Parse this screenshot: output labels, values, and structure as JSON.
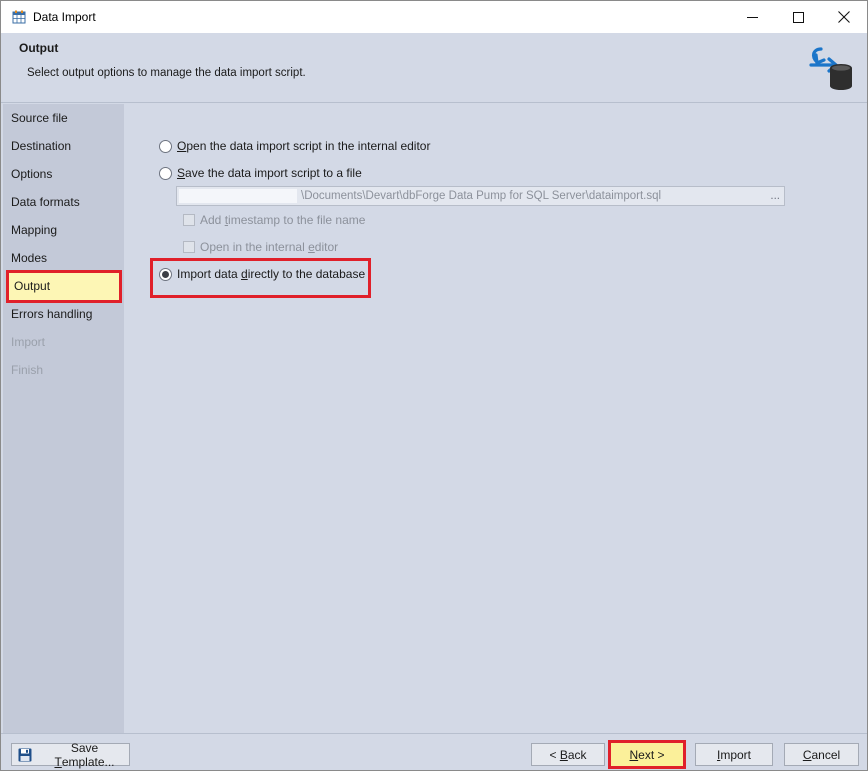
{
  "window": {
    "title": "Data Import",
    "controls": {
      "minimize": "minimize",
      "maximize": "maximize",
      "close": "close"
    }
  },
  "header": {
    "title": "Output",
    "subtitle": "Select output options to manage the data import script."
  },
  "sidebar": {
    "items": [
      {
        "label": "Source file",
        "state": "normal"
      },
      {
        "label": "Destination",
        "state": "normal"
      },
      {
        "label": "Options",
        "state": "normal"
      },
      {
        "label": "Data formats",
        "state": "normal"
      },
      {
        "label": "Mapping",
        "state": "normal"
      },
      {
        "label": "Modes",
        "state": "normal"
      },
      {
        "label": "Output",
        "state": "active"
      },
      {
        "label": "Errors handling",
        "state": "normal"
      },
      {
        "label": "Import",
        "state": "disabled"
      },
      {
        "label": "Finish",
        "state": "disabled"
      }
    ]
  },
  "output": {
    "option_open_editor": {
      "pre": "",
      "access": "O",
      "post": "pen the data import script in the internal editor",
      "selected": false
    },
    "option_save_file": {
      "pre": "",
      "access": "S",
      "post": "ave the data import script to a file",
      "selected": false
    },
    "file_path": "\\Documents\\Devart\\dbForge Data Pump for SQL Server\\dataimport.sql",
    "browse_label": "...",
    "check_timestamp": {
      "pre": "Add ",
      "access": "t",
      "post": "imestamp to the file name",
      "checked": false,
      "enabled": false
    },
    "check_open_editor": {
      "pre": "Open in the internal ",
      "access": "e",
      "post": "ditor",
      "checked": false,
      "enabled": false
    },
    "option_import_direct": {
      "pre": "Import data ",
      "access": "d",
      "post": "irectly to the database",
      "selected": true
    }
  },
  "footer": {
    "save_template": {
      "pre": "Save ",
      "access": "T",
      "post": "emplate..."
    },
    "back": {
      "pre": "< ",
      "access": "B",
      "post": "ack"
    },
    "next": {
      "pre": "",
      "access": "N",
      "post": "ext >"
    },
    "import": {
      "pre": "",
      "access": "I",
      "post": "mport"
    },
    "cancel": {
      "pre": "",
      "access": "C",
      "post": "ancel"
    }
  },
  "colors": {
    "highlight_border": "#e0202a",
    "active_item_bg": "#fdf6b5",
    "panel_bg": "#d3d9e6",
    "sidebar_bg": "#c3c9d8",
    "disabled_text": "#9aa0ab"
  },
  "icons": {
    "app": "data-import-icon",
    "header": "database-import-icon",
    "save": "floppy-disk-icon"
  }
}
